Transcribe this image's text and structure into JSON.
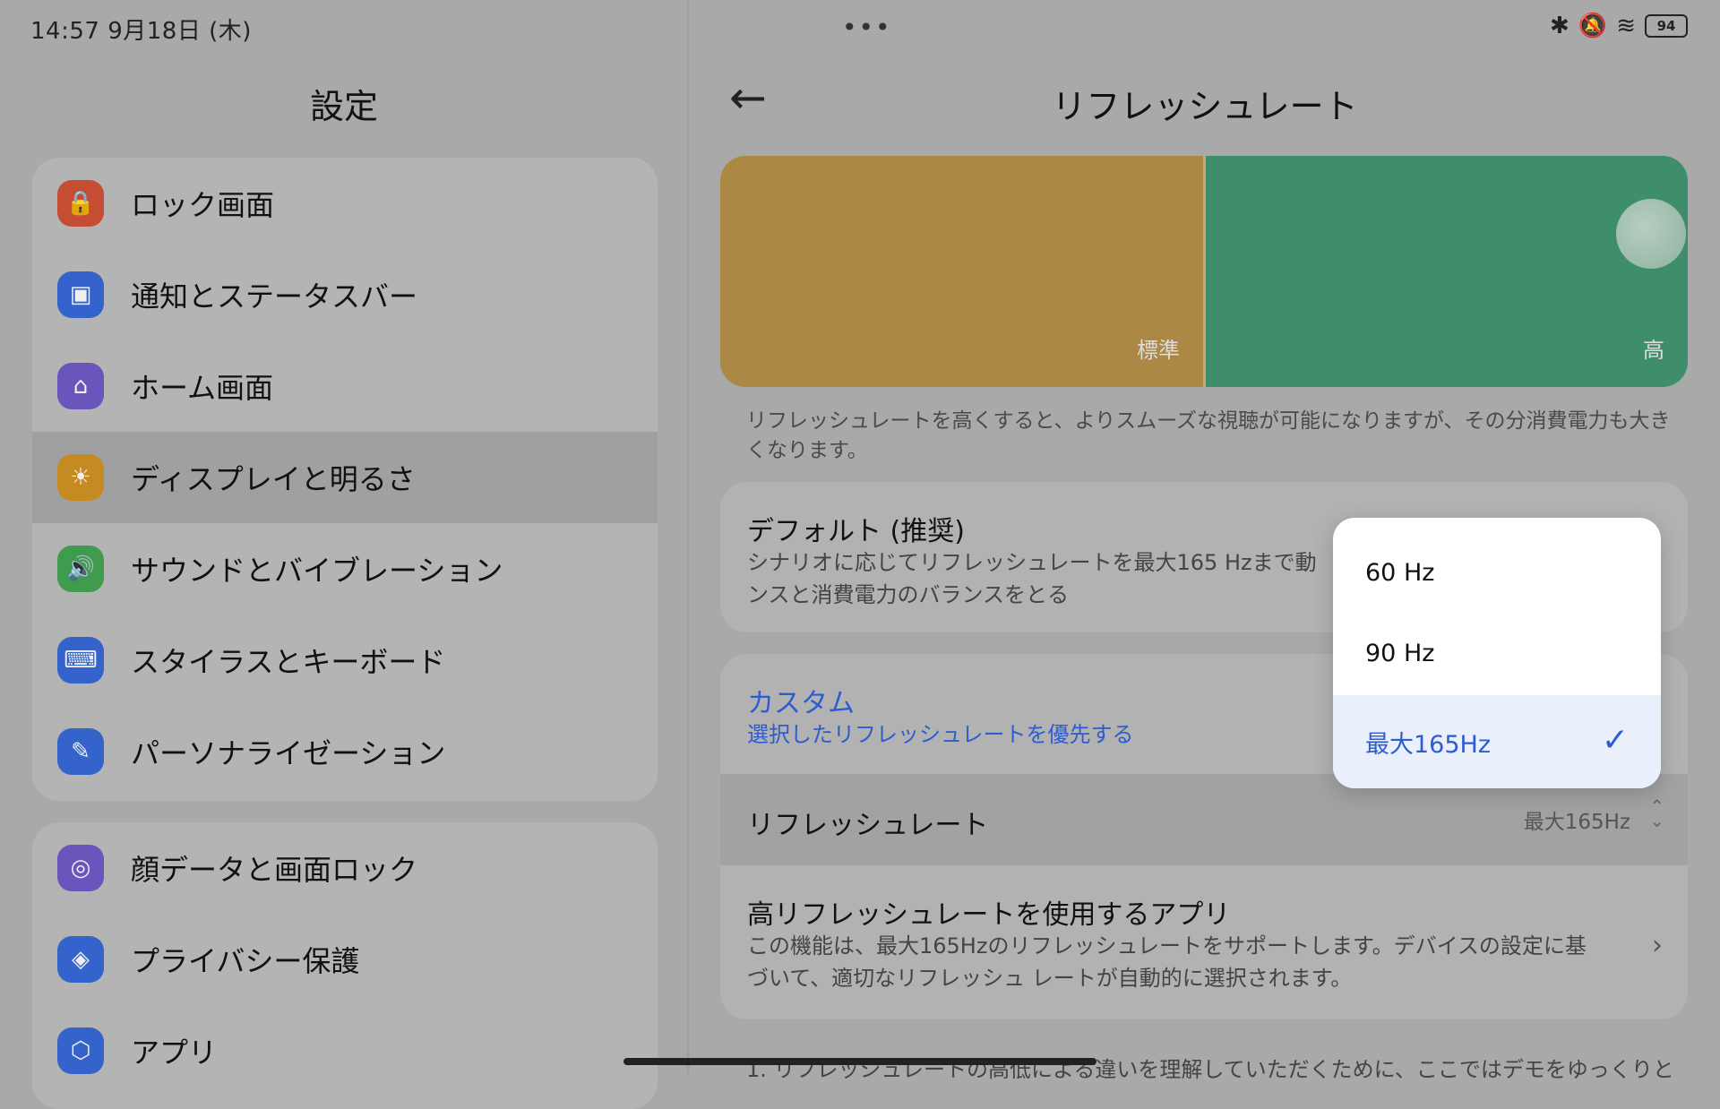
{
  "status_bar": {
    "time_date": "14:57   9月18日 (木)",
    "battery": "94",
    "icons": [
      "bluetooth-icon",
      "mute-vibrate-icon",
      "wifi-icon",
      "battery-icon"
    ]
  },
  "left_panel": {
    "title": "設定",
    "group1": [
      {
        "label": "ロック画面",
        "icon": "lock-icon",
        "color": "#c44d33"
      },
      {
        "label": "通知とステータスバー",
        "icon": "notification-icon",
        "color": "#3463cc"
      },
      {
        "label": "ホーム画面",
        "icon": "home-icon",
        "color": "#6a55bd"
      },
      {
        "label": "ディスプレイと明るさ",
        "icon": "sun-icon",
        "color": "#c58b22"
      },
      {
        "label": "サウンドとバイブレーション",
        "icon": "speaker-icon",
        "color": "#3f9b4e"
      },
      {
        "label": "スタイラスとキーボード",
        "icon": "keyboard-icon",
        "color": "#3463cc"
      },
      {
        "label": "パーソナライゼーション",
        "icon": "brush-icon",
        "color": "#3463cc"
      }
    ],
    "group2": [
      {
        "label": "顔データと画面ロック",
        "icon": "face-id-icon",
        "color": "#6a55bd"
      },
      {
        "label": "プライバシー保護",
        "icon": "privacy-icon",
        "color": "#3463cc"
      },
      {
        "label": "アプリ",
        "icon": "apps-icon",
        "color": "#3463cc"
      }
    ]
  },
  "right_panel": {
    "title": "リフレッシュレート",
    "banner": {
      "standard_label": "標準",
      "high_label": "高"
    },
    "description": "リフレッシュレートを高くすると、よりスムーズな視聴が可能になりますが、その分消費電力も大きくなります。",
    "default_option": {
      "title": "デフォルト (推奨)",
      "subtitle_line1": "シナリオに応じてリフレッシュレートを最大165 Hzまで動",
      "subtitle_line2": "ンスと消費電力のバランスをとる"
    },
    "custom_option": {
      "title": "カスタム",
      "subtitle": "選択したリフレッシュレートを優先する"
    },
    "refresh_rate_row": {
      "label": "リフレッシュレート",
      "value": "最大165Hz"
    },
    "high_rate_apps": {
      "title": "高リフレッシュレートを使用するアプリ",
      "line1": "この機能は、最大165Hzのリフレッシュレートをサポートします。デバイスの設定に基",
      "line2": "づいて、適切なリフレッシュ レートが自動的に選択されます。"
    },
    "footnote": "1. リフレッシュレートの高低による違いを理解していただくために、ここではデモをゆっくりと"
  },
  "dropdown": {
    "options": [
      "60 Hz",
      "90 Hz",
      "最大165Hz"
    ],
    "selected": "最大165Hz",
    "accent": "#2d5bd0"
  }
}
